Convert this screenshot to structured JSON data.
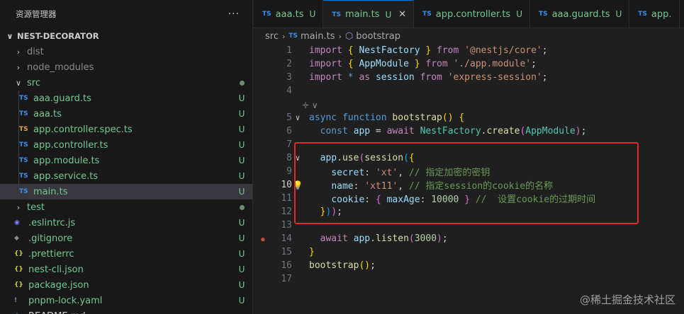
{
  "explorer": {
    "title": "资源管理器",
    "more": "···",
    "project": "NEST-DECORATOR",
    "items": [
      {
        "name": "dist",
        "type": "folder",
        "collapsed": true,
        "depth": 0,
        "status": ""
      },
      {
        "name": "node_modules",
        "type": "folder",
        "collapsed": true,
        "depth": 0,
        "status": ""
      },
      {
        "name": "src",
        "type": "folder",
        "collapsed": false,
        "depth": 0,
        "status": "dot"
      },
      {
        "name": "aaa.guard.ts",
        "type": "ts",
        "depth": 1,
        "status": "U"
      },
      {
        "name": "aaa.ts",
        "type": "ts",
        "depth": 1,
        "status": "U"
      },
      {
        "name": "app.controller.spec.ts",
        "type": "ts-test",
        "depth": 1,
        "status": "U"
      },
      {
        "name": "app.controller.ts",
        "type": "ts",
        "depth": 1,
        "status": "U"
      },
      {
        "name": "app.module.ts",
        "type": "ts",
        "depth": 1,
        "status": "U"
      },
      {
        "name": "app.service.ts",
        "type": "ts",
        "depth": 1,
        "status": "U"
      },
      {
        "name": "main.ts",
        "type": "ts",
        "depth": 1,
        "status": "U",
        "selected": true
      },
      {
        "name": "test",
        "type": "folder",
        "collapsed": true,
        "depth": 0,
        "status": "dot"
      },
      {
        "name": ".eslintrc.js",
        "type": "eslint",
        "depth": 0,
        "status": "U"
      },
      {
        "name": ".gitignore",
        "type": "git",
        "depth": 0,
        "status": "U"
      },
      {
        "name": ".prettierrc",
        "type": "json",
        "depth": 0,
        "status": "U"
      },
      {
        "name": "nest-cli.json",
        "type": "json",
        "depth": 0,
        "status": "U"
      },
      {
        "name": "package.json",
        "type": "json",
        "depth": 0,
        "status": "U"
      },
      {
        "name": "pnpm-lock.yaml",
        "type": "yaml",
        "depth": 0,
        "status": "U"
      },
      {
        "name": "README.md",
        "type": "md",
        "depth": 0,
        "status": ""
      }
    ]
  },
  "tabs": [
    {
      "badge": "TS",
      "name": "aaa.ts",
      "status": "U",
      "active": false
    },
    {
      "badge": "TS",
      "name": "main.ts",
      "status": "U",
      "active": true,
      "close": "✕"
    },
    {
      "badge": "TS",
      "name": "app.controller.ts",
      "status": "U",
      "active": false
    },
    {
      "badge": "TS",
      "name": "aaa.guard.ts",
      "status": "U",
      "active": false
    },
    {
      "badge": "TS",
      "name": "app.",
      "status": "",
      "active": false
    }
  ],
  "breadcrumb": {
    "folder": "src",
    "file": "main.ts",
    "symbol": "bootstrap",
    "badge": "TS"
  },
  "editor": {
    "codelens": "🝊 ∨",
    "lines": [
      {
        "n": "1",
        "html": "<span class='kw2'>import</span> <span class='brk1'>{</span> <span class='var'>NestFactory</span> <span class='brk1'>}</span> <span class='kw2'>from</span> <span class='str'>'@nestjs/core'</span>;"
      },
      {
        "n": "2",
        "html": "<span class='kw2'>import</span> <span class='brk1'>{</span> <span class='var'>AppModule</span> <span class='brk1'>}</span> <span class='kw2'>from</span> <span class='str'>'./app.module'</span>;"
      },
      {
        "n": "3",
        "html": "<span class='kw2'>import</span> <span class='kw'>*</span> <span class='kw2'>as</span> <span class='var'>session</span> <span class='kw2'>from</span> <span class='str'>'express-session'</span>;"
      },
      {
        "n": "4",
        "html": ""
      },
      {
        "n": "5",
        "fold": true,
        "html": "<span class='kw'>async</span> <span class='kw'>function</span> <span class='fn'>bootstrap</span><span class='brk1'>()</span> <span class='brk1'>{</span>"
      },
      {
        "n": "6",
        "html": "  <span class='kw'>const</span> <span class='var'>app</span> = <span class='kw2'>await</span> <span class='cls'>NestFactory</span>.<span class='fn'>create</span><span class='brk2'>(</span><span class='cls'>AppModule</span><span class='brk2'>)</span>;"
      },
      {
        "n": "7",
        "html": ""
      },
      {
        "n": "8",
        "fold": true,
        "html": "  <span class='var'>app</span>.<span class='fn'>use</span><span class='brk2'>(</span><span class='fn'>session</span><span class='brk3'>(</span><span class='brk1'>{</span>"
      },
      {
        "n": "9",
        "html": "    <span class='var'>secret</span>: <span class='str'>'xt'</span>, <span class='cmt'>// 指定加密的密钥</span>"
      },
      {
        "n": "10",
        "current": true,
        "bulb": true,
        "html": "    <span class='var'>name</span>: <span class='str'>'xt11'</span>, <span class='cmt'>// 指定session的cookie的名称</span>"
      },
      {
        "n": "11",
        "html": "    <span class='var'>cookie</span>: <span class='brk2'>{</span> <span class='var'>maxAge</span>: <span class='num'>10000</span> <span class='brk2'>}</span> <span class='cmt'>//  设置cookie的过期时间</span>"
      },
      {
        "n": "12",
        "html": "  <span class='brk1'>}</span><span class='brk3'>)</span><span class='brk2'>)</span>;"
      },
      {
        "n": "13",
        "html": ""
      },
      {
        "n": "14",
        "bp": true,
        "html": "  <span class='kw2'>await</span> <span class='var'>app</span>.<span class='fn'>listen</span><span class='brk2'>(</span><span class='num'>3000</span><span class='brk2'>)</span>;"
      },
      {
        "n": "15",
        "html": "<span class='brk1'>}</span>"
      },
      {
        "n": "16",
        "html": "<span class='fn'>bootstrap</span><span class='brk1'>()</span>;"
      },
      {
        "n": "17",
        "html": ""
      }
    ]
  },
  "watermark": "@稀土掘金技术社区"
}
